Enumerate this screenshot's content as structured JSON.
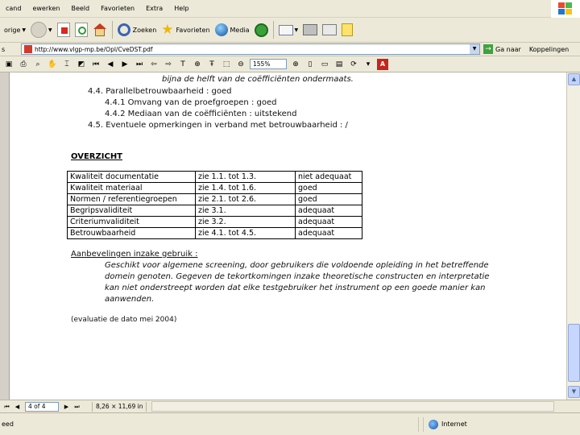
{
  "menu": {
    "items": [
      "cand",
      "ewerken",
      "Beeld",
      "Favorieten",
      "Extra",
      "Help"
    ]
  },
  "toolbar": {
    "back_label": "orige",
    "search_label": "Zoeken",
    "favorites_label": "Favorieten",
    "media_label": "Media"
  },
  "address": {
    "label": "s",
    "url": "http://www.vlgp-mp.be/Opl/CveDST.pdf",
    "go_label": "Ga naar",
    "links_label": "Koppelingen"
  },
  "acrobat": {
    "zoom": "155%"
  },
  "document": {
    "line_top_fragment": "bijna de helft van de coëfficiënten ondermaats.",
    "s44": "4.4.  Parallelbetrouwbaarheid : goed",
    "s441": "4.4.1 Omvang van de proefgroepen : goed",
    "s442": "4.4.2 Mediaan van de coëfficiënten : uitstekend",
    "s45": "4.5.  Eventuele opmerkingen in verband met betrouwbaarheid : /",
    "overview_title": "OVERZICHT",
    "overview_rows": [
      [
        "Kwaliteit documentatie",
        "zie 1.1. tot 1.3.",
        "niet adequaat"
      ],
      [
        "Kwaliteit materiaal",
        "zie 1.4. tot 1.6.",
        "goed"
      ],
      [
        "Normen / referentiegroepen",
        "zie 2.1. tot 2.6.",
        "goed"
      ],
      [
        "Begripsvaliditeit",
        "zie 3.1.",
        "adequaat"
      ],
      [
        "Criteriumvaliditeit",
        "zie 3.2.",
        "adequaat"
      ],
      [
        "Betrouwbaarheid",
        "zie 4.1. tot 4.5.",
        "adequaat"
      ]
    ],
    "recommendations_title": "Aanbevelingen inzake gebruik :",
    "recommendations_text_line1": "Geschikt voor algemene screening, door gebruikers die voldoende opleiding in het betreffende",
    "recommendations_text_line2": "domein genoten. Gegeven de tekortkomingen inzake theoretische constructen en interpretatie",
    "recommendations_text_line3": "kan niet onderstreept worden dat elke testgebruiker het instrument op een goede manier kan",
    "recommendations_text_line4": "aanwenden.",
    "evaluation_note": "(evaluatie de dato mei 2004)"
  },
  "pager": {
    "page_indicator": "4 of 4",
    "page_size": "8,26 × 11,69 in"
  },
  "status": {
    "left_text": "eed",
    "zone_label": "Internet"
  },
  "colors": {
    "chrome": "#ece9d8",
    "ie_blue": "#1c4fa5",
    "scroll_thumb": "#c6d6fc"
  }
}
